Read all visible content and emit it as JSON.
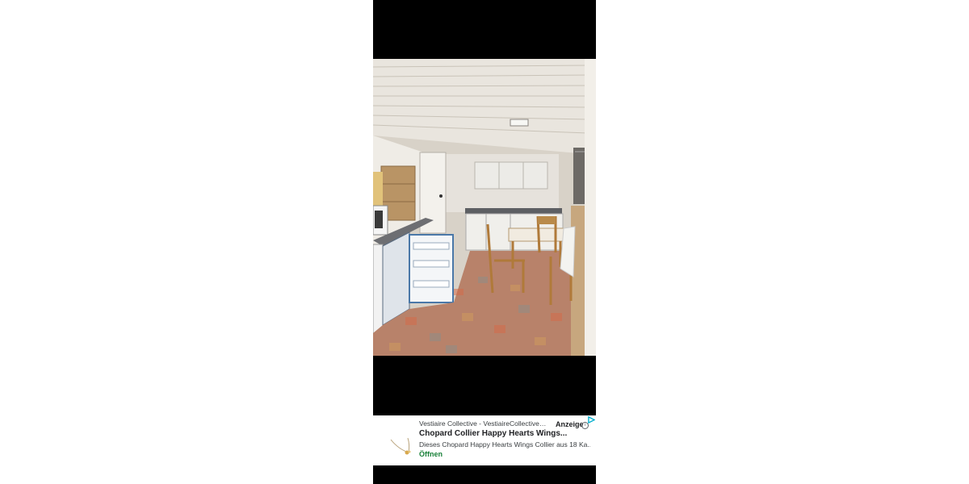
{
  "viewer": {
    "photo_subject_icon": "kitchen-photo"
  },
  "ad": {
    "source": "Vestiaire Collective - VestiaireCollective....",
    "label": "Anzeige",
    "title": "Chopard Collier Happy Hearts Wings...",
    "description": "Dieses Chopard Happy Hearts Wings Collier aus 18 Ka...",
    "cta": "Öffnen",
    "cta_color": "#188038",
    "adchoices_color": "#00aecd"
  }
}
